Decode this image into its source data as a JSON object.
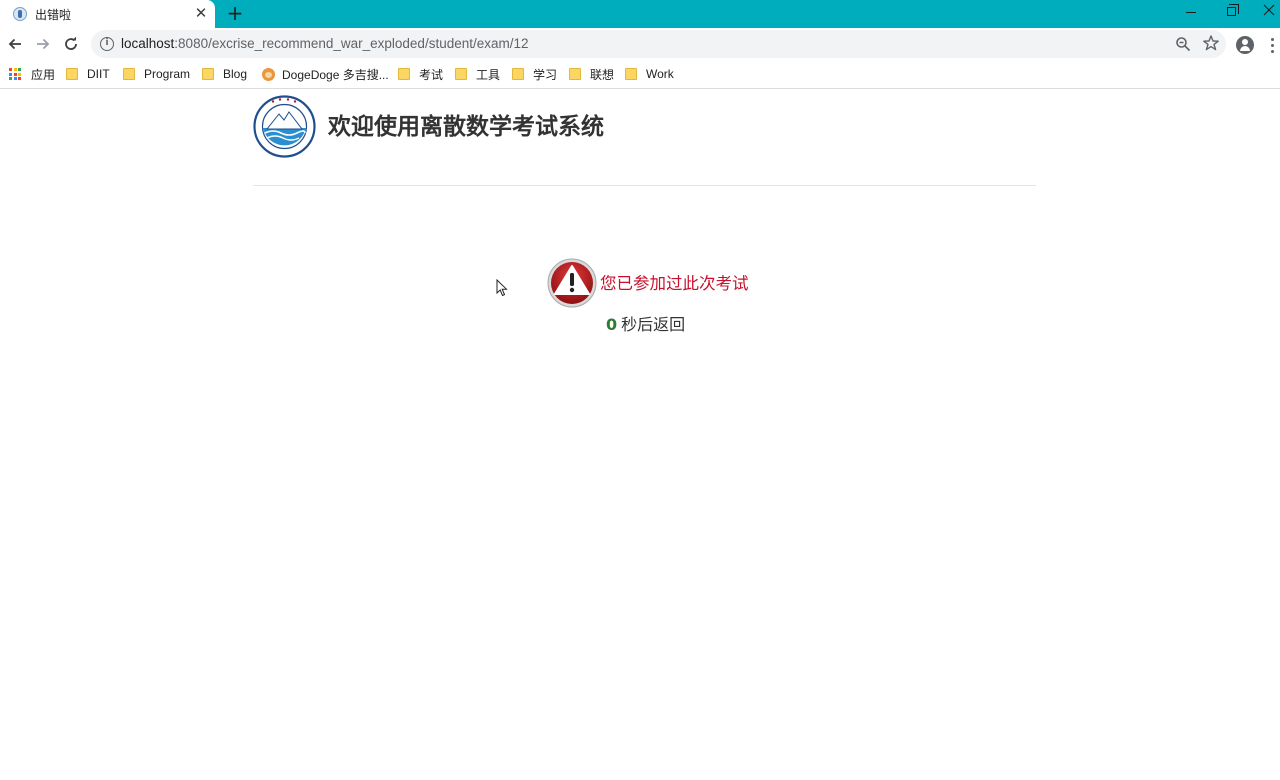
{
  "browser": {
    "tab": {
      "title": "出错啦",
      "close_glyph": "✕"
    },
    "new_tab_glyph": "+",
    "omnibox": {
      "url_host": "localhost",
      "url_rest": ":8080/excrise_recommend_war_exploded/student/exam/12"
    },
    "bookmarks": [
      {
        "label": "应用",
        "icon": "apps-grid-icon"
      },
      {
        "label": "DIIT",
        "icon": "folder-icon"
      },
      {
        "label": "Program",
        "icon": "folder-icon"
      },
      {
        "label": "Blog",
        "icon": "folder-icon"
      },
      {
        "label": "DogeDoge 多吉搜...",
        "icon": "dogedoge-favicon"
      },
      {
        "label": "考试",
        "icon": "folder-icon"
      },
      {
        "label": "工具",
        "icon": "folder-icon"
      },
      {
        "label": "学习",
        "icon": "folder-icon"
      },
      {
        "label": "联想",
        "icon": "folder-icon"
      },
      {
        "label": "Work",
        "icon": "folder-icon"
      }
    ]
  },
  "page": {
    "title": "欢迎使用离散数学考试系统",
    "alert_message": "您已参加过此次考试",
    "countdown_value": "0",
    "countdown_suffix": "秒后返回"
  },
  "colors": {
    "titlebar": "#00adbd",
    "alert_text": "#c8102e",
    "countdown_number": "#2e7d32"
  }
}
